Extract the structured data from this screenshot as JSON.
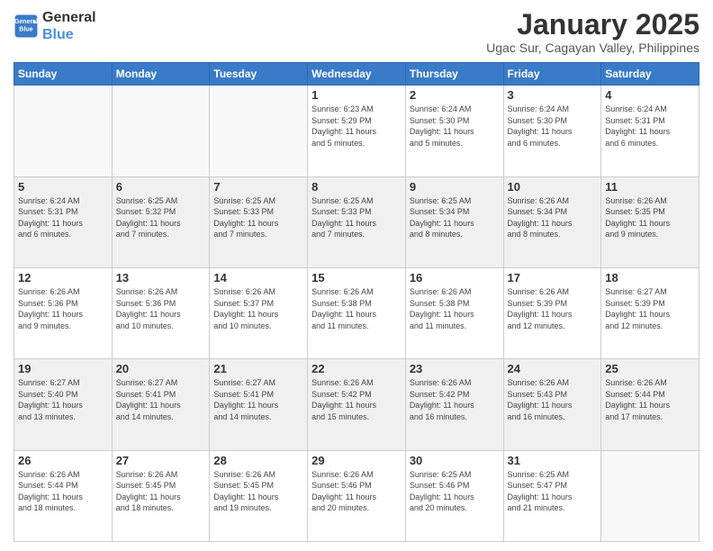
{
  "header": {
    "logo_line1": "General",
    "logo_line2": "Blue",
    "month": "January 2025",
    "location": "Ugac Sur, Cagayan Valley, Philippines"
  },
  "weekdays": [
    "Sunday",
    "Monday",
    "Tuesday",
    "Wednesday",
    "Thursday",
    "Friday",
    "Saturday"
  ],
  "weeks": [
    [
      {
        "day": "",
        "info": ""
      },
      {
        "day": "",
        "info": ""
      },
      {
        "day": "",
        "info": ""
      },
      {
        "day": "1",
        "info": "Sunrise: 6:23 AM\nSunset: 5:29 PM\nDaylight: 11 hours\nand 5 minutes."
      },
      {
        "day": "2",
        "info": "Sunrise: 6:24 AM\nSunset: 5:30 PM\nDaylight: 11 hours\nand 5 minutes."
      },
      {
        "day": "3",
        "info": "Sunrise: 6:24 AM\nSunset: 5:30 PM\nDaylight: 11 hours\nand 6 minutes."
      },
      {
        "day": "4",
        "info": "Sunrise: 6:24 AM\nSunset: 5:31 PM\nDaylight: 11 hours\nand 6 minutes."
      }
    ],
    [
      {
        "day": "5",
        "info": "Sunrise: 6:24 AM\nSunset: 5:31 PM\nDaylight: 11 hours\nand 6 minutes."
      },
      {
        "day": "6",
        "info": "Sunrise: 6:25 AM\nSunset: 5:32 PM\nDaylight: 11 hours\nand 7 minutes."
      },
      {
        "day": "7",
        "info": "Sunrise: 6:25 AM\nSunset: 5:33 PM\nDaylight: 11 hours\nand 7 minutes."
      },
      {
        "day": "8",
        "info": "Sunrise: 6:25 AM\nSunset: 5:33 PM\nDaylight: 11 hours\nand 7 minutes."
      },
      {
        "day": "9",
        "info": "Sunrise: 6:25 AM\nSunset: 5:34 PM\nDaylight: 11 hours\nand 8 minutes."
      },
      {
        "day": "10",
        "info": "Sunrise: 6:26 AM\nSunset: 5:34 PM\nDaylight: 11 hours\nand 8 minutes."
      },
      {
        "day": "11",
        "info": "Sunrise: 6:26 AM\nSunset: 5:35 PM\nDaylight: 11 hours\nand 9 minutes."
      }
    ],
    [
      {
        "day": "12",
        "info": "Sunrise: 6:26 AM\nSunset: 5:36 PM\nDaylight: 11 hours\nand 9 minutes."
      },
      {
        "day": "13",
        "info": "Sunrise: 6:26 AM\nSunset: 5:36 PM\nDaylight: 11 hours\nand 10 minutes."
      },
      {
        "day": "14",
        "info": "Sunrise: 6:26 AM\nSunset: 5:37 PM\nDaylight: 11 hours\nand 10 minutes."
      },
      {
        "day": "15",
        "info": "Sunrise: 6:26 AM\nSunset: 5:38 PM\nDaylight: 11 hours\nand 11 minutes."
      },
      {
        "day": "16",
        "info": "Sunrise: 6:26 AM\nSunset: 5:38 PM\nDaylight: 11 hours\nand 11 minutes."
      },
      {
        "day": "17",
        "info": "Sunrise: 6:26 AM\nSunset: 5:39 PM\nDaylight: 11 hours\nand 12 minutes."
      },
      {
        "day": "18",
        "info": "Sunrise: 6:27 AM\nSunset: 5:39 PM\nDaylight: 11 hours\nand 12 minutes."
      }
    ],
    [
      {
        "day": "19",
        "info": "Sunrise: 6:27 AM\nSunset: 5:40 PM\nDaylight: 11 hours\nand 13 minutes."
      },
      {
        "day": "20",
        "info": "Sunrise: 6:27 AM\nSunset: 5:41 PM\nDaylight: 11 hours\nand 14 minutes."
      },
      {
        "day": "21",
        "info": "Sunrise: 6:27 AM\nSunset: 5:41 PM\nDaylight: 11 hours\nand 14 minutes."
      },
      {
        "day": "22",
        "info": "Sunrise: 6:26 AM\nSunset: 5:42 PM\nDaylight: 11 hours\nand 15 minutes."
      },
      {
        "day": "23",
        "info": "Sunrise: 6:26 AM\nSunset: 5:42 PM\nDaylight: 11 hours\nand 16 minutes."
      },
      {
        "day": "24",
        "info": "Sunrise: 6:26 AM\nSunset: 5:43 PM\nDaylight: 11 hours\nand 16 minutes."
      },
      {
        "day": "25",
        "info": "Sunrise: 6:26 AM\nSunset: 5:44 PM\nDaylight: 11 hours\nand 17 minutes."
      }
    ],
    [
      {
        "day": "26",
        "info": "Sunrise: 6:26 AM\nSunset: 5:44 PM\nDaylight: 11 hours\nand 18 minutes."
      },
      {
        "day": "27",
        "info": "Sunrise: 6:26 AM\nSunset: 5:45 PM\nDaylight: 11 hours\nand 18 minutes."
      },
      {
        "day": "28",
        "info": "Sunrise: 6:26 AM\nSunset: 5:45 PM\nDaylight: 11 hours\nand 19 minutes."
      },
      {
        "day": "29",
        "info": "Sunrise: 6:26 AM\nSunset: 5:46 PM\nDaylight: 11 hours\nand 20 minutes."
      },
      {
        "day": "30",
        "info": "Sunrise: 6:25 AM\nSunset: 5:46 PM\nDaylight: 11 hours\nand 20 minutes."
      },
      {
        "day": "31",
        "info": "Sunrise: 6:25 AM\nSunset: 5:47 PM\nDaylight: 11 hours\nand 21 minutes."
      },
      {
        "day": "",
        "info": ""
      }
    ]
  ]
}
